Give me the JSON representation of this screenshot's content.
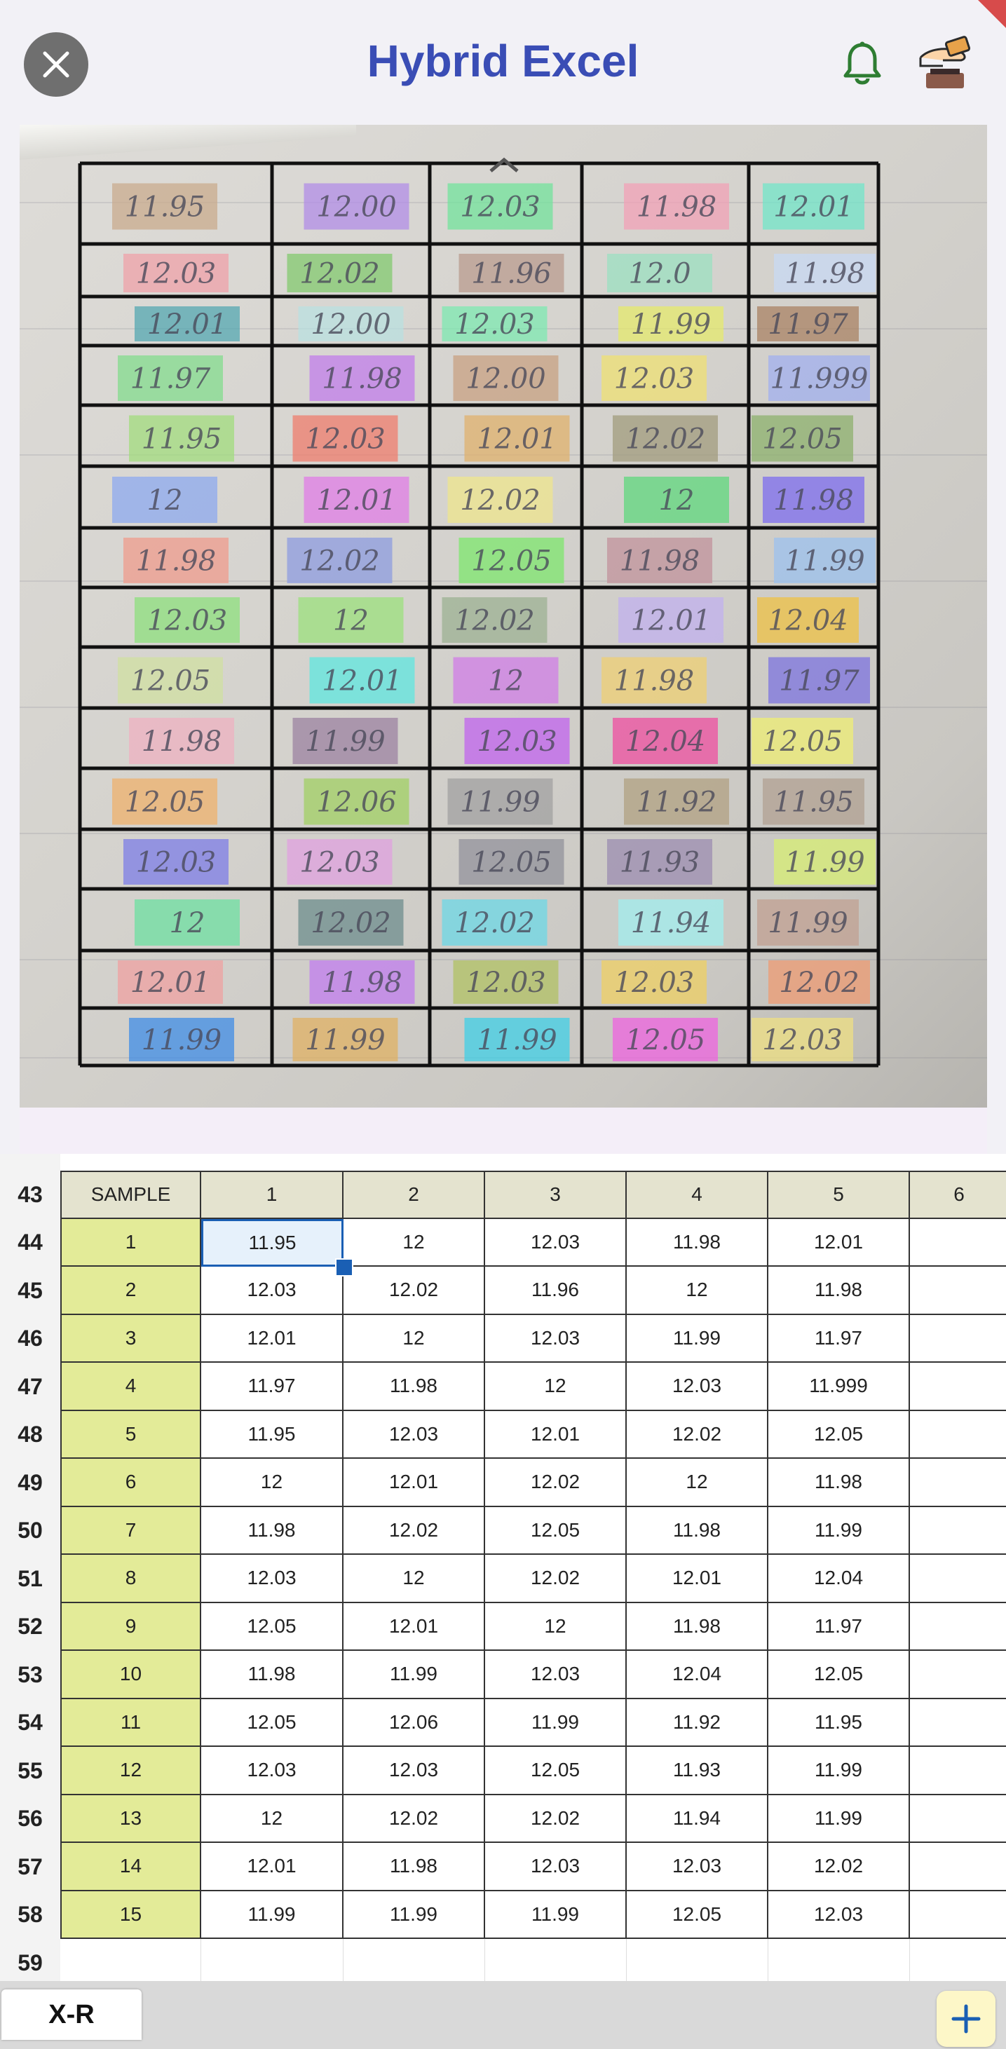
{
  "header": {
    "title": "Hybrid Excel"
  },
  "photo": {
    "cells": [
      [
        "11.95",
        "12.00",
        "12.03",
        "11.98",
        "12.01"
      ],
      [
        "12.03",
        "12.02",
        "11.96",
        "12.0",
        "11.98"
      ],
      [
        "12.01",
        "12.00",
        "12.03",
        "11.99",
        "11.97"
      ],
      [
        "11.97",
        "11.98",
        "12.00",
        "12.03",
        "11.999"
      ],
      [
        "11.95",
        "12.03",
        "12.01",
        "12.02",
        "12.05"
      ],
      [
        "12",
        "12.01",
        "12.02",
        "12",
        "11.98"
      ],
      [
        "11.98",
        "12.02",
        "12.05",
        "11.98",
        "11.99"
      ],
      [
        "12.03",
        "12",
        "12.02",
        "12.01",
        "12.04"
      ],
      [
        "12.05",
        "12.01",
        "12",
        "11.98",
        "11.97"
      ],
      [
        "11.98",
        "11.99",
        "12.03",
        "12.04",
        "12.05"
      ],
      [
        "12.05",
        "12.06",
        "11.99",
        "11.92",
        "11.95"
      ],
      [
        "12.03",
        "12.03",
        "12.05",
        "11.93",
        "11.99"
      ],
      [
        "12",
        "12.02",
        "12.02",
        "11.94",
        "11.99"
      ],
      [
        "12.01",
        "11.98",
        "12.03",
        "12.03",
        "12.02"
      ],
      [
        "11.99",
        "11.99",
        "11.99",
        "12.05",
        "12.03"
      ]
    ],
    "highlight_colors": [
      "#c9a98a",
      "#b08be8",
      "#6fe39a",
      "#f2a0b6",
      "#6fe6c9",
      "#f0a0a8",
      "#7fc96b",
      "#b89a8c",
      "#9ae0c0",
      "#c8daf5",
      "#4fa6b0",
      "#b9e0e0",
      "#7aeab0",
      "#e6ea6a",
      "#a88060",
      "#7fdc8a",
      "#c07aeb",
      "#c8a080",
      "#f0e070",
      "#a0aef0",
      "#9fdc7a",
      "#f07a6a",
      "#e0b06a",
      "#a09a7a",
      "#8ab06a",
      "#8aa8f0",
      "#e07ae8",
      "#f0e68a",
      "#5ad87a",
      "#7a6af0",
      "#f09a8a",
      "#8a9ae0",
      "#7ae86a",
      "#c0909a",
      "#9ac0f0",
      "#8ae07a",
      "#9ae07a",
      "#9ab090",
      "#c0b0f0",
      "#f0c040",
      "#d0e0a0",
      "#5ae8e0",
      "#d07ae8",
      "#f0d070",
      "#7a70e0",
      "#f0b0c0",
      "#9a80a0",
      "#c060f0",
      "#f04aa0",
      "#f0f070",
      "#f0b06a",
      "#a0d060",
      "#a0a0a0",
      "#b0a080",
      "#b0a090",
      "#7a7ae8",
      "#e0a0e0",
      "#90909a",
      "#9a8ab0",
      "#d8f070",
      "#6ae0a0",
      "#6a8a8a",
      "#6ad8e8",
      "#a0f0f0",
      "#c0a090",
      "#f0a0a0",
      "#c07af0",
      "#b0c060",
      "#f0d060",
      "#f09a70",
      "#3a8ae8",
      "#e0b060",
      "#3ad0e8",
      "#f060e0",
      "#f0e080"
    ]
  },
  "sheet": {
    "header_row": {
      "row_num": "43",
      "sample_label": "SAMPLE",
      "columns": [
        "1",
        "2",
        "3",
        "4",
        "5",
        "6"
      ]
    },
    "rows": [
      {
        "row_num": "44",
        "sample": "1",
        "values": [
          "11.95",
          "12",
          "12.03",
          "11.98",
          "12.01"
        ]
      },
      {
        "row_num": "45",
        "sample": "2",
        "values": [
          "12.03",
          "12.02",
          "11.96",
          "12",
          "11.98"
        ]
      },
      {
        "row_num": "46",
        "sample": "3",
        "values": [
          "12.01",
          "12",
          "12.03",
          "11.99",
          "11.97"
        ]
      },
      {
        "row_num": "47",
        "sample": "4",
        "values": [
          "11.97",
          "11.98",
          "12",
          "12.03",
          "11.999"
        ]
      },
      {
        "row_num": "48",
        "sample": "5",
        "values": [
          "11.95",
          "12.03",
          "12.01",
          "12.02",
          "12.05"
        ]
      },
      {
        "row_num": "49",
        "sample": "6",
        "values": [
          "12",
          "12.01",
          "12.02",
          "12",
          "11.98"
        ]
      },
      {
        "row_num": "50",
        "sample": "7",
        "values": [
          "11.98",
          "12.02",
          "12.05",
          "11.98",
          "11.99"
        ]
      },
      {
        "row_num": "51",
        "sample": "8",
        "values": [
          "12.03",
          "12",
          "12.02",
          "12.01",
          "12.04"
        ]
      },
      {
        "row_num": "52",
        "sample": "9",
        "values": [
          "12.05",
          "12.01",
          "12",
          "11.98",
          "11.97"
        ]
      },
      {
        "row_num": "53",
        "sample": "10",
        "values": [
          "11.98",
          "11.99",
          "12.03",
          "12.04",
          "12.05"
        ]
      },
      {
        "row_num": "54",
        "sample": "11",
        "values": [
          "12.05",
          "12.06",
          "11.99",
          "11.92",
          "11.95"
        ]
      },
      {
        "row_num": "55",
        "sample": "12",
        "values": [
          "12.03",
          "12.03",
          "12.05",
          "11.93",
          "11.99"
        ]
      },
      {
        "row_num": "56",
        "sample": "13",
        "values": [
          "12",
          "12.02",
          "12.02",
          "11.94",
          "11.99"
        ]
      },
      {
        "row_num": "57",
        "sample": "14",
        "values": [
          "12.01",
          "11.98",
          "12.03",
          "12.03",
          "12.02"
        ]
      },
      {
        "row_num": "58",
        "sample": "15",
        "values": [
          "11.99",
          "11.99",
          "11.99",
          "12.05",
          "12.03"
        ]
      }
    ],
    "empty_row": {
      "row_num": "59"
    }
  },
  "bottom_bar": {
    "tab_label": "X-R"
  },
  "icons": [
    "close-icon",
    "bell-icon",
    "hand-card-icon",
    "chevron-up-icon",
    "plus-icon"
  ],
  "colors": {
    "title": "#3a4db5",
    "bell": "#2e7d32",
    "header_fill": "#e4e3cf",
    "sample_fill": "#e3eb98",
    "selection": "#1a5fb4",
    "add_button": "#fdf7c8"
  }
}
